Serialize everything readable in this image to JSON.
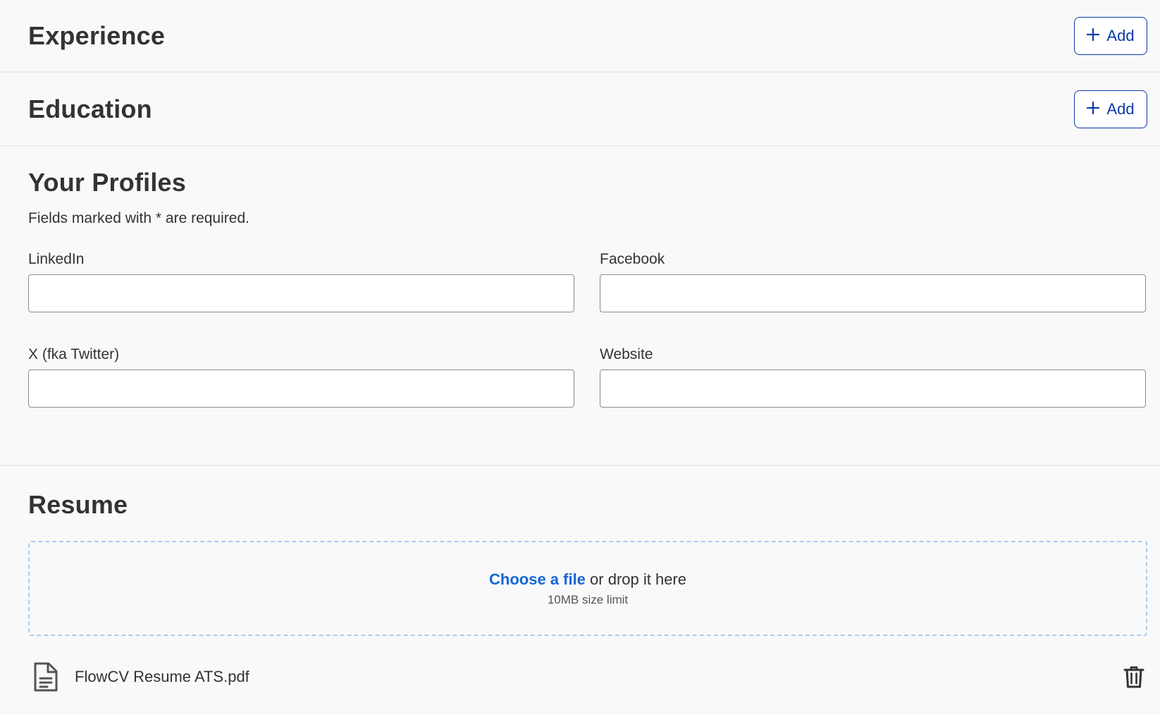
{
  "experience": {
    "title": "Experience",
    "add_label": "Add"
  },
  "education": {
    "title": "Education",
    "add_label": "Add"
  },
  "profiles": {
    "title": "Your Profiles",
    "required_note": "Fields marked with * are required.",
    "fields": [
      {
        "label": "LinkedIn",
        "value": ""
      },
      {
        "label": "Facebook",
        "value": ""
      },
      {
        "label": "X (fka Twitter)",
        "value": ""
      },
      {
        "label": "Website",
        "value": ""
      }
    ]
  },
  "resume": {
    "title": "Resume",
    "choose_link": "Choose a file",
    "drop_text": " or drop it here",
    "size_limit": "10MB size limit",
    "file_name": "FlowCV Resume ATS.pdf"
  },
  "icons": {
    "add": "plus-icon",
    "file": "document-icon",
    "delete": "trash-icon"
  },
  "colors": {
    "accent": "#0b3aa6",
    "link": "#1565d8",
    "dropzone_border": "#a9cdee",
    "background": "#f9f9f9"
  }
}
